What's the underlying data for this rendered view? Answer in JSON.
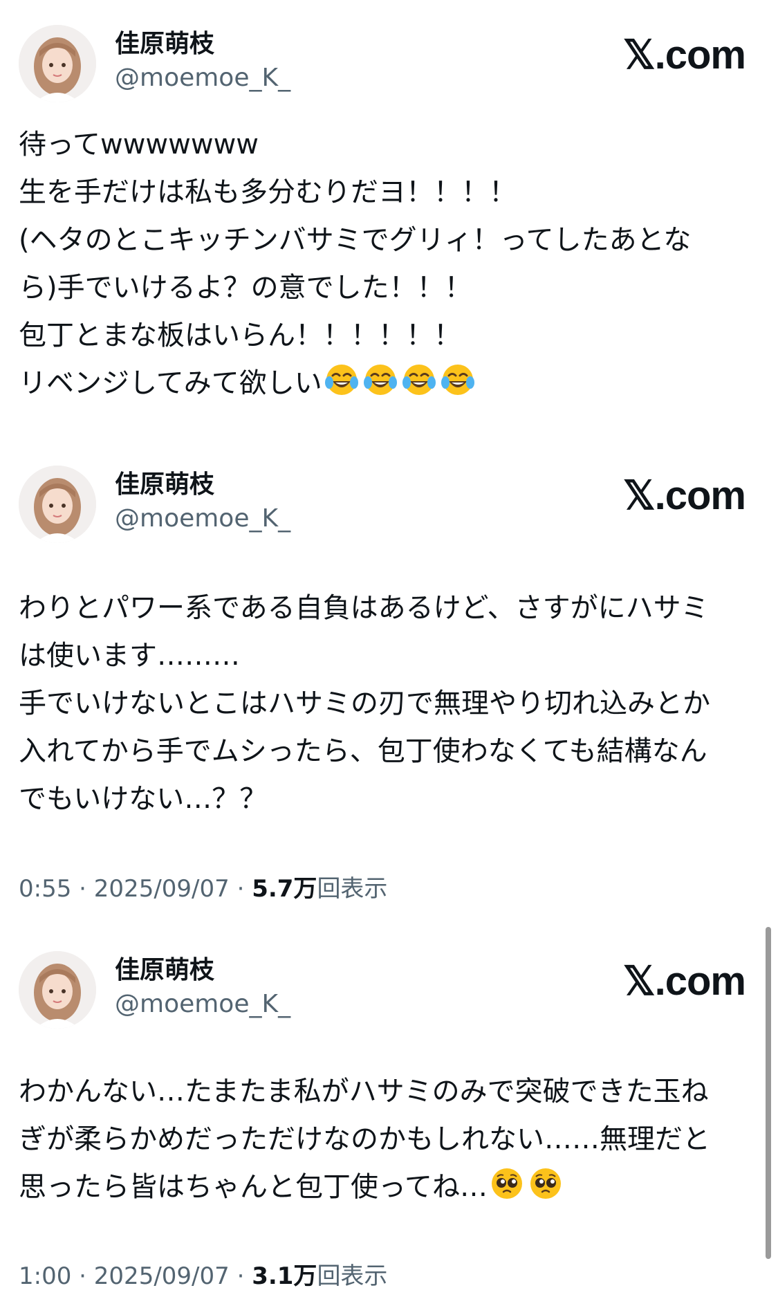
{
  "brand_label": "𝕏.com",
  "emoji": {
    "laugh": "face-with-tears-of-joy",
    "plead": "pleading-face"
  },
  "tweets": [
    {
      "name": "佳原萌枝",
      "handle": "@moemoe_K_",
      "lines": [
        "待ってwwwwwww",
        "生を手だけは私も多分むりだヨ！！！！",
        "(ヘタのとこキッチンバサミでグリィ！ってしたあとな",
        "ら)手でいけるよ？の意でした！！！",
        "包丁とまな板はいらん！！！！！！",
        "リベンジしてみて欲しい"
      ],
      "trailing_emoji_count": 4
    },
    {
      "name": "佳原萌枝",
      "handle": "@moemoe_K_",
      "lines": [
        "わりとパワー系である自負はあるけど、さすがにハサミ",
        "は使います………",
        "手でいけないとこはハサミの刃で無理やり切れ込みとか",
        "入れてから手でムシったら、包丁使わなくても結構なん",
        "でもいけない…？？"
      ],
      "time": "0:55",
      "date": "2025/09/07",
      "views": "5.7万",
      "views_label": "回表示"
    },
    {
      "name": "佳原萌枝",
      "handle": "@moemoe_K_",
      "lines": [
        "わかんない…たまたま私がハサミのみで突破できた玉ね",
        "ぎが柔らかめだっただけなのかもしれない……無理だと",
        "思ったら皆はちゃんと包丁使ってね…"
      ],
      "trailing_emoji_count": 2,
      "time": "1:00",
      "date": "2025/09/07",
      "views": "3.1万",
      "views_label": "回表示"
    }
  ]
}
